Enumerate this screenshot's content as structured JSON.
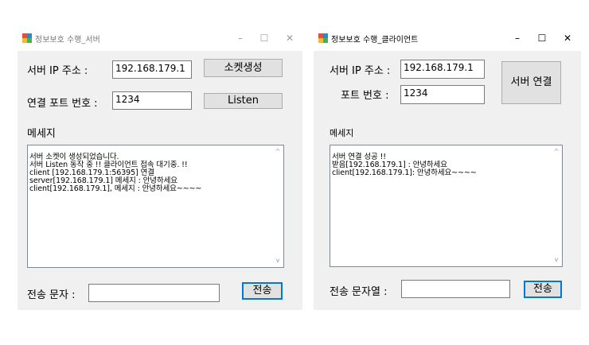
{
  "server": {
    "title": "정보보호 수행_서버",
    "ip_label": "서버 IP 주소 :",
    "ip_value": "192.168.179.1",
    "create_socket_label": "소켓생성",
    "port_label": "연결 포트 번호 :",
    "port_value": "1234",
    "listen_label": "Listen",
    "message_label": "메세지",
    "messages": "서버 소켓이 생성되었습니다.\n서버 Listen 동작 중 !! 클라이언트 접속 대기중. !!\nclient [192.168.179.1:56395] 연결\nserver[192.168.179.1] 메세지 : 안녕하세요\nclient[192.168.179.1], 메세지 : 안녕하세요~~~~",
    "send_label": "전송 문자 :",
    "send_value": "",
    "send_button": "전송"
  },
  "client": {
    "title": "정보보호 수행_클라이언트",
    "ip_label": "서버 IP 주소 :",
    "ip_value": "192.168.179.1",
    "port_label": "포트 번호 :",
    "port_value": "1234",
    "connect_label": "서버 연결",
    "message_label": "메세지",
    "messages": "서버 연결 성공 !!\n받음[192.168.179.1] : 안녕하세요\nclient[192.168.179.1]: 안녕하세요~~~~",
    "send_label": "전송 문자열 :",
    "send_value": "",
    "send_button": "전송"
  },
  "window_controls": {
    "minimize": "–",
    "maximize": "☐",
    "close": "✕"
  }
}
